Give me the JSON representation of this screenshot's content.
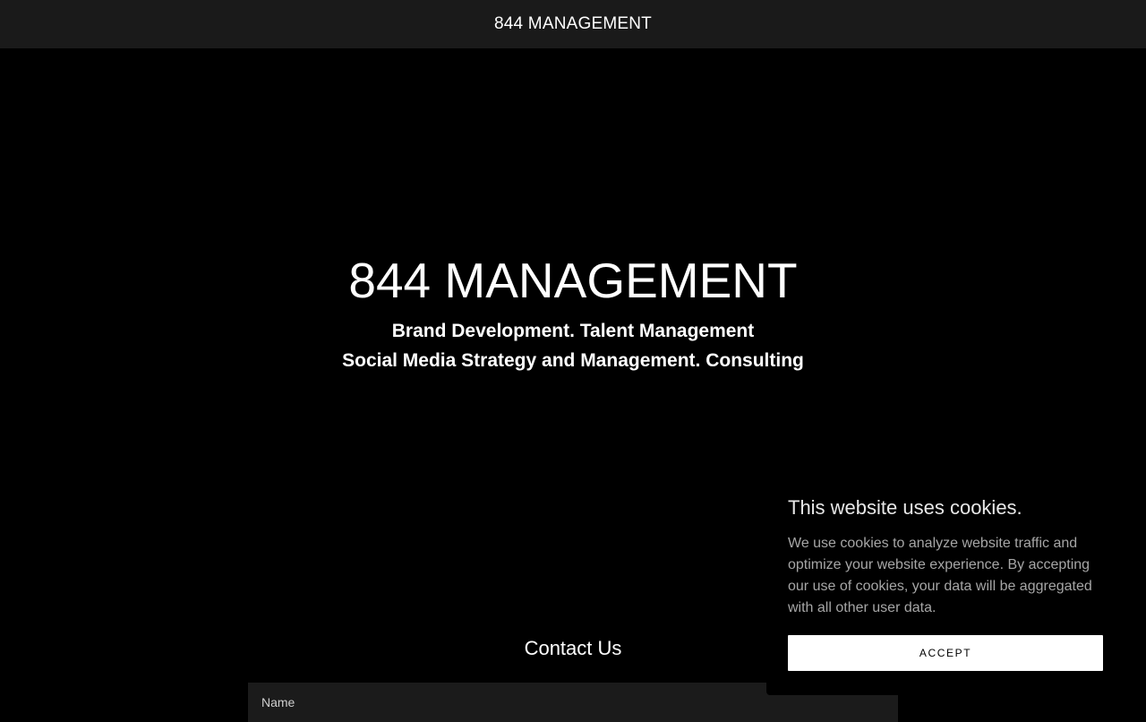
{
  "header": {
    "brand": "844 MANAGEMENT"
  },
  "hero": {
    "title": "844 MANAGEMENT",
    "tagline_line1": "Brand Development. Talent Management",
    "tagline_line2": "Social Media Strategy and Management. Consulting"
  },
  "contact": {
    "heading": "Contact Us",
    "name_placeholder": "Name",
    "name_value": ""
  },
  "cookie_banner": {
    "title": "This website uses cookies.",
    "body": "We use cookies to analyze website traffic and optimize your website experience. By accepting our use of cookies, your data will be aggregated with all other user data.",
    "accept_label": "ACCEPT"
  },
  "colors": {
    "page_background": "#000000",
    "header_background": "#1a1a1a",
    "field_background": "#1b1b1b",
    "cookie_text": "#a6a6a6",
    "accept_button": "#ffffff"
  }
}
